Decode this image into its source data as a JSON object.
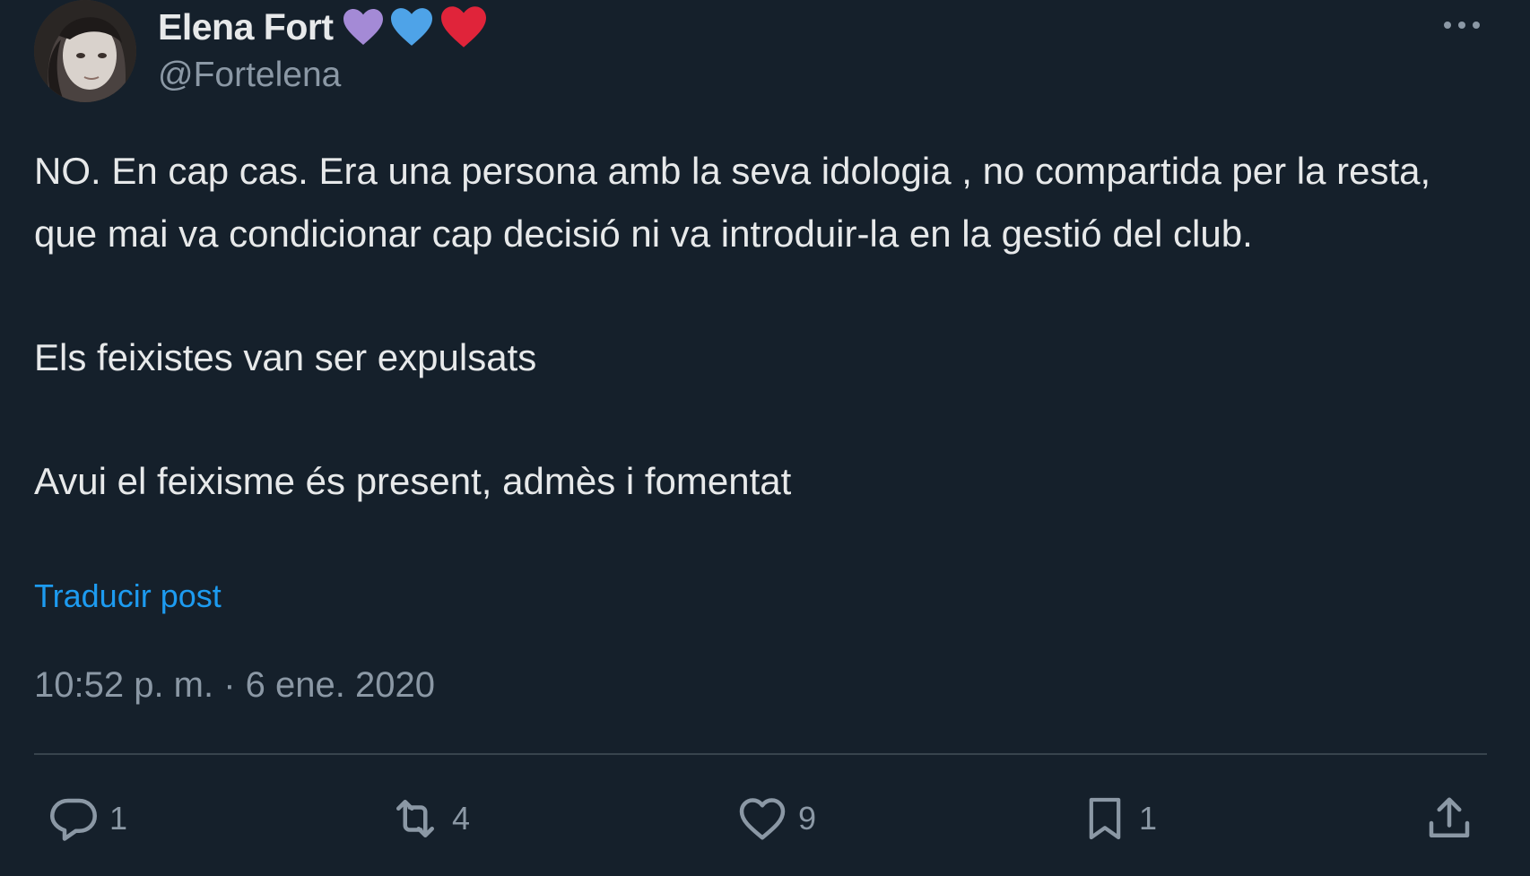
{
  "author": {
    "display_name": "Elena Fort",
    "handle": "@Fortelena",
    "emojis": [
      "purple-heart",
      "blue-heart",
      "red-heart"
    ]
  },
  "post": {
    "paragraphs": [
      "NO. En cap cas. Era una persona amb la seva idologia , no compartida per la resta, que mai va condicionar cap decisió ni va introduir-la en la gestió del club.",
      "Els feixistes van ser expulsats",
      "Avui el feixisme és present, admès i fomentat"
    ],
    "translate_label": "Traducir post",
    "timestamp": "10:52 p. m. · 6 ene. 2020"
  },
  "actions": {
    "reply": {
      "icon": "reply-icon",
      "count": "1"
    },
    "repost": {
      "icon": "repost-icon",
      "count": "4"
    },
    "like": {
      "icon": "heart-icon",
      "count": "9"
    },
    "bookmark": {
      "icon": "bookmark-icon",
      "count": "1"
    },
    "share": {
      "icon": "share-icon"
    }
  },
  "colors": {
    "background": "#15202b",
    "text": "#e7e9ea",
    "secondary": "#8b98a5",
    "link": "#1d9bf0",
    "divider": "#38444d"
  }
}
